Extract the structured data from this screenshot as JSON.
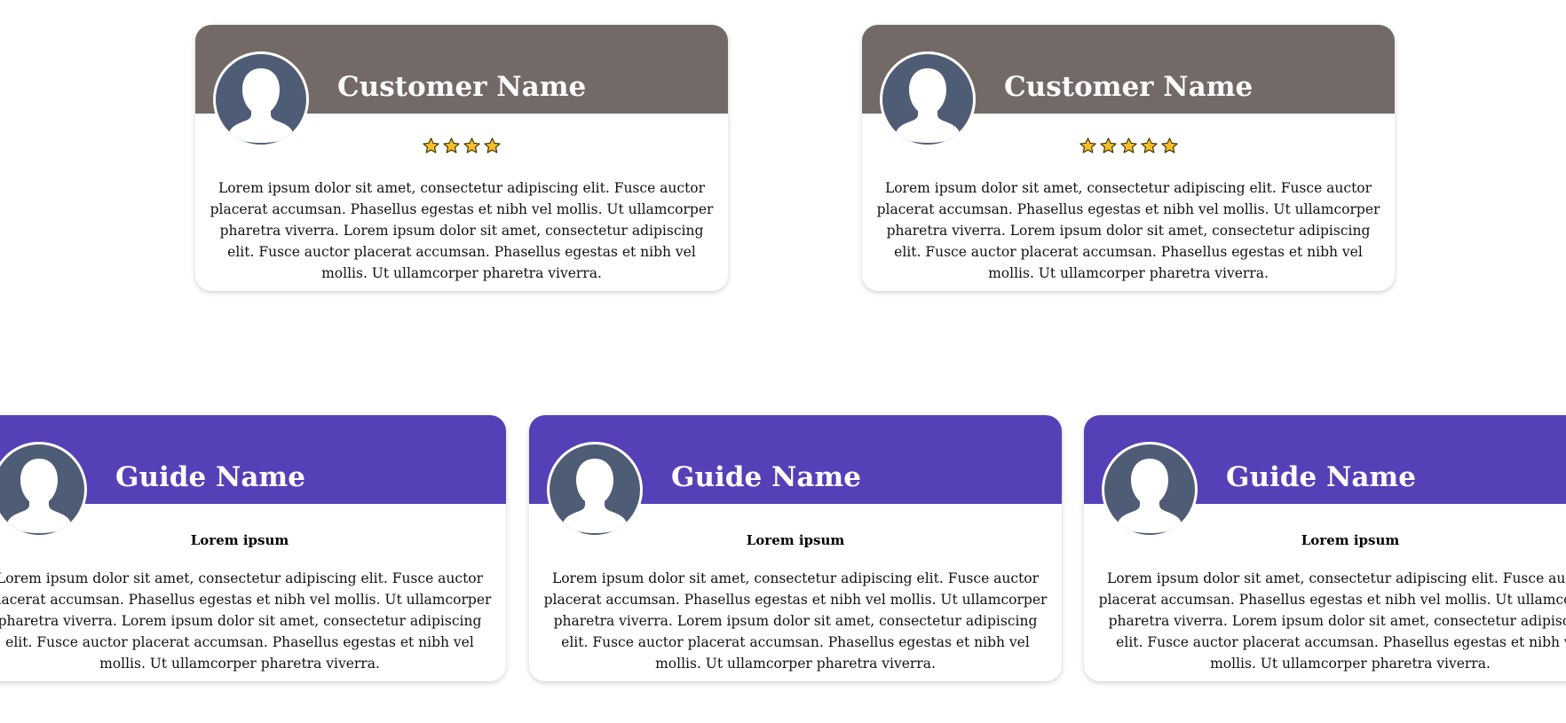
{
  "colors": {
    "customer_header": "#736a68",
    "guide_header": "#5540b8",
    "avatar_bg": "#4f5c75",
    "star_fill": "#f5bf2a",
    "star_stroke": "#3a3000"
  },
  "customers": [
    {
      "name": "Customer Name",
      "rating": 4,
      "avatar_icon": "user-silhouette-icon",
      "text": "Lorem ipsum dolor sit amet, consectetur adipiscing elit. Fusce auctor placerat accumsan. Phasellus egestas et nibh vel mollis. Ut ullamcorper pharetra viverra. Lorem ipsum dolor sit amet, consectetur adipiscing elit. Fusce auctor placerat accumsan. Phasellus egestas et nibh vel mollis. Ut ullamcorper pharetra viverra."
    },
    {
      "name": "Customer Name",
      "rating": 5,
      "avatar_icon": "user-silhouette-icon",
      "text": "Lorem ipsum dolor sit amet, consectetur adipiscing elit. Fusce auctor placerat accumsan. Phasellus egestas et nibh vel mollis. Ut ullamcorper pharetra viverra. Lorem ipsum dolor sit amet, consectetur adipiscing elit. Fusce auctor placerat accumsan. Phasellus egestas et nibh vel mollis. Ut ullamcorper pharetra viverra."
    }
  ],
  "guides": [
    {
      "name": "Guide Name",
      "role": "Lorem ipsum",
      "avatar_icon": "user-silhouette-icon",
      "text": "Lorem ipsum dolor sit amet, consectetur adipiscing elit. Fusce auctor placerat accumsan. Phasellus egestas et nibh vel mollis. Ut ullamcorper pharetra viverra. Lorem ipsum dolor sit amet, consectetur adipiscing elit. Fusce auctor placerat accumsan. Phasellus egestas et nibh vel mollis. Ut ullamcorper pharetra viverra."
    },
    {
      "name": "Guide Name",
      "role": "Lorem ipsum",
      "avatar_icon": "user-silhouette-icon",
      "text": "Lorem ipsum dolor sit amet, consectetur adipiscing elit. Fusce auctor placerat accumsan. Phasellus egestas et nibh vel mollis. Ut ullamcorper pharetra viverra. Lorem ipsum dolor sit amet, consectetur adipiscing elit. Fusce auctor placerat accumsan. Phasellus egestas et nibh vel mollis. Ut ullamcorper pharetra viverra."
    },
    {
      "name": "Guide Name",
      "role": "Lorem ipsum",
      "avatar_icon": "user-silhouette-icon",
      "text": "Lorem ipsum dolor sit amet, consectetur adipiscing elit. Fusce auctor placerat accumsan. Phasellus egestas et nibh vel mollis. Ut ullamcorper pharetra viverra. Lorem ipsum dolor sit amet, consectetur adipiscing elit. Fusce auctor placerat accumsan. Phasellus egestas et nibh vel mollis. Ut ullamcorper pharetra viverra."
    }
  ]
}
